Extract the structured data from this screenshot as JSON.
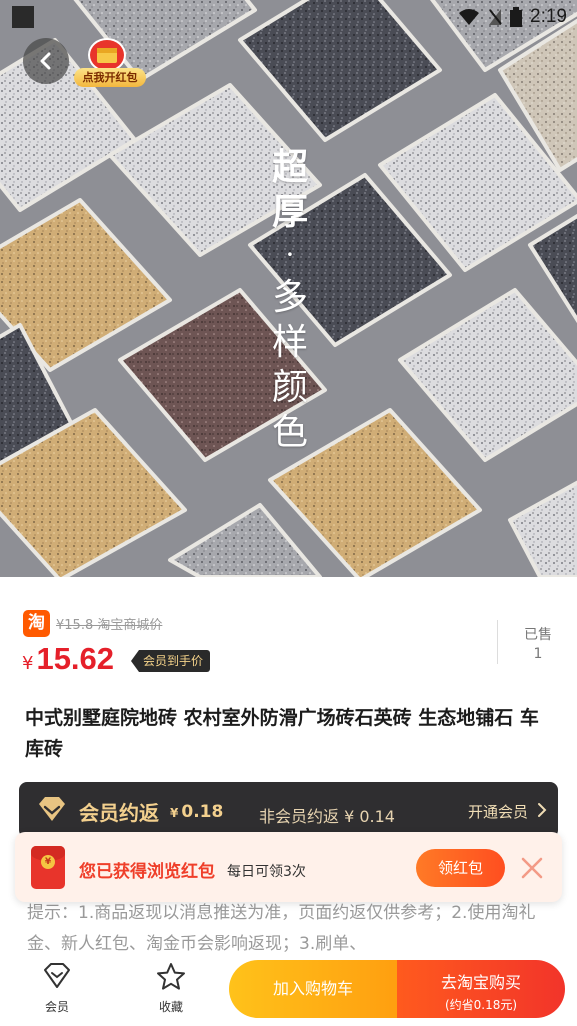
{
  "status_bar": {
    "time": "2:19"
  },
  "float": {
    "redpacket_label": "点我开红包"
  },
  "hero": {
    "overlay_text": [
      "超",
      "厚",
      "·",
      "多",
      "样",
      "颜",
      "色"
    ]
  },
  "price": {
    "platform_icon": "淘",
    "original": "¥15.8 淘宝商城价",
    "currency": "¥",
    "current": "15.62",
    "member_tag": "会员到手价",
    "sold_label": "已售",
    "sold_count": "1"
  },
  "product": {
    "title": "中式别墅庭院地砖 农村室外防滑广场砖石英砖 生态地铺石 车库砖"
  },
  "member_bar": {
    "title": "会员约返",
    "currency": "¥",
    "member_value": "0.18",
    "nonmember": "非会员约返 ¥ 0.14",
    "open": "开通会员"
  },
  "notice": {
    "coin": "¥",
    "main": "您已获得浏览红包",
    "sub": "每日可领3次",
    "button": "领红包"
  },
  "tips": {
    "text": "提示：1.商品返现以消息推送为准，页面约返仅供参考；2.使用淘礼金、新人红包、淘金币会影响返现；3.刷单、"
  },
  "bottom_bar": {
    "member": "会员",
    "favorite": "收藏",
    "cart": "加入购物车",
    "buy": "去淘宝购买",
    "buy_sub": "(约省0.18元)"
  },
  "colors": {
    "price_red": "#e5202a",
    "gold": "#f3d08e",
    "cart_orange": "#ffb015",
    "buy_red": "#f2342a"
  },
  "icons": [
    "back-arrow-icon",
    "redpacket-icon",
    "diamond-icon",
    "chevron-right-icon",
    "close-icon",
    "member-heart-icon",
    "star-icon",
    "wifi-icon",
    "signal-icon",
    "battery-icon"
  ]
}
